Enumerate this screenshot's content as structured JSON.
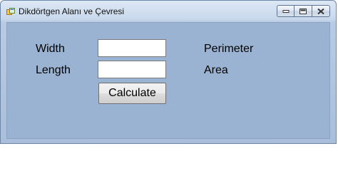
{
  "window": {
    "title": "Dikdörtgen Alanı ve Çevresi",
    "icon": "app-form-icon",
    "controls": {
      "minimize_icon": "minimize-icon",
      "maximize_icon": "maximize-icon",
      "close_icon": "close-icon"
    }
  },
  "form": {
    "width_label": "Width",
    "length_label": "Length",
    "width_value": "",
    "length_value": "",
    "perimeter_label": "Perimeter",
    "area_label": "Area",
    "calculate_label": "Calculate"
  },
  "colors": {
    "client_background": "#9bb3d2",
    "title_gradient_top": "#dde8f5"
  }
}
